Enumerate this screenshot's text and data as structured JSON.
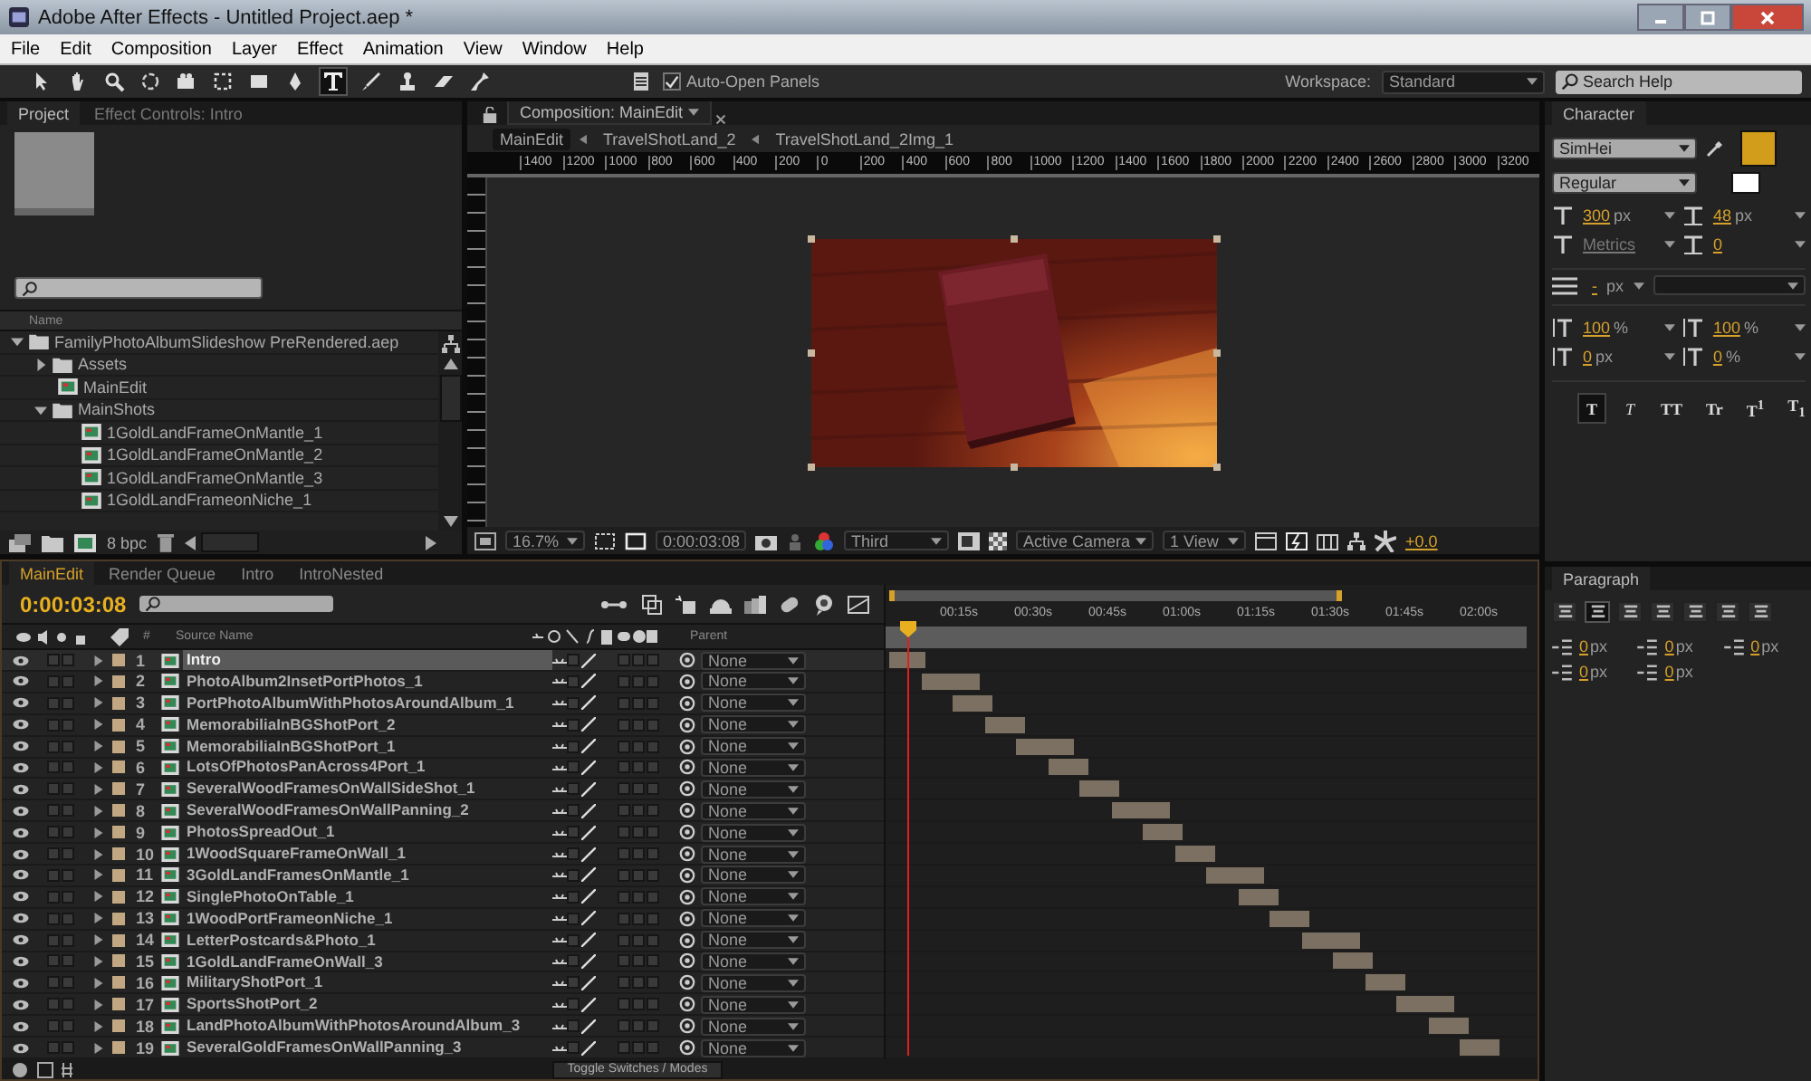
{
  "window": {
    "title": "Adobe After Effects - Untitled Project.aep *"
  },
  "menu": [
    "File",
    "Edit",
    "Composition",
    "Layer",
    "Effect",
    "Animation",
    "View",
    "Window",
    "Help"
  ],
  "toolbar": {
    "auto_open_panels": {
      "label": "Auto-Open Panels",
      "checked": true
    },
    "workspace_label": "Workspace:",
    "workspace": "Standard",
    "search_placeholder": "Search Help"
  },
  "project": {
    "tabs": [
      {
        "label": "Project",
        "selected": true
      },
      {
        "label": "Effect Controls: Intro",
        "selected": false
      }
    ],
    "column": "Name",
    "bpc": "8 bpc",
    "items": [
      {
        "name": "FamilyPhotoAlbumSlideshow PreRendered.aep",
        "kind": "folder",
        "expanded": true,
        "children": [
          {
            "name": "Assets",
            "kind": "folder",
            "expanded": false
          },
          {
            "name": "MainEdit",
            "kind": "comp"
          },
          {
            "name": "MainShots",
            "kind": "folder",
            "expanded": true,
            "children": [
              {
                "name": "1GoldLandFrameOnMantle_1",
                "kind": "comp"
              },
              {
                "name": "1GoldLandFrameOnMantle_2",
                "kind": "comp"
              },
              {
                "name": "1GoldLandFrameOnMantle_3",
                "kind": "comp"
              },
              {
                "name": "1GoldLandFrameonNiche_1",
                "kind": "comp"
              }
            ]
          }
        ]
      }
    ]
  },
  "composition": {
    "tab": "Composition: MainEdit",
    "breadcrumbs": [
      {
        "label": "MainEdit",
        "selected": true
      },
      {
        "label": "TravelShotLand_2",
        "selected": false
      },
      {
        "label": "TravelShotLand_2Img_1",
        "selected": false
      }
    ],
    "ruler": [
      "1400",
      "1200",
      "1000",
      "800",
      "600",
      "400",
      "200",
      "0",
      "200",
      "400",
      "600",
      "800",
      "1000",
      "1200",
      "1400",
      "1600",
      "1800",
      "2000",
      "2200",
      "2400",
      "2600",
      "2800",
      "3000",
      "3200"
    ],
    "zoom": "16.7%",
    "timecode": "0:00:03:08",
    "resolution": "Third",
    "camera": "Active Camera",
    "views": "1 View",
    "exposure": "+0.0"
  },
  "character": {
    "tab": "Character",
    "font": "SimHei",
    "style": "Regular",
    "fields": [
      {
        "value": "300",
        "unit": "px"
      },
      {
        "value": "48",
        "unit": "px"
      },
      {
        "value": "Metrics"
      },
      {
        "value": "0"
      }
    ],
    "stroke": {
      "value": "-",
      "unit": "px"
    },
    "scale_fields": [
      {
        "value": "100",
        "unit": "%"
      },
      {
        "value": "100",
        "unit": "%"
      },
      {
        "value": "0",
        "unit": "px"
      },
      {
        "value": "0",
        "unit": "%"
      }
    ],
    "styles": [
      {
        "label": "T",
        "selected": true
      },
      {
        "label": "T",
        "selected": false
      },
      {
        "label": "TT",
        "selected": false
      },
      {
        "label": "Tr",
        "selected": false
      },
      {
        "label": "T$^{1}$",
        "selected": false
      },
      {
        "label": "T$_{1}$",
        "selected": false
      }
    ]
  },
  "paragraph": {
    "tab": "Paragraph",
    "alignments": [
      {
        "selected": false
      },
      {
        "selected": true
      },
      {
        "selected": false
      },
      {
        "selected": false
      },
      {
        "selected": false
      },
      {
        "selected": false
      },
      {
        "selected": false
      }
    ],
    "indents": [
      {
        "value": "0",
        "unit": "px"
      },
      {
        "value": "0",
        "unit": "px"
      },
      {
        "value": "0",
        "unit": "px"
      },
      {
        "value": "0",
        "unit": "px"
      },
      {
        "value": "0",
        "unit": "px"
      }
    ]
  },
  "timeline": {
    "tabs": [
      {
        "label": "MainEdit",
        "selected": true
      },
      {
        "label": "Render Queue",
        "selected": false
      },
      {
        "label": "Intro",
        "selected": false
      },
      {
        "label": "IntroNested",
        "selected": false
      }
    ],
    "timecode": "0:00:03:08",
    "columns": {
      "number": "#",
      "source": "Source Name",
      "parent": "Parent"
    },
    "time_ticks": [
      "00:15s",
      "00:30s",
      "00:45s",
      "01:00s",
      "01:15s",
      "01:30s",
      "01:45s",
      "02:00s"
    ],
    "layers": [
      {
        "number": "1",
        "name": "Intro",
        "parent": "None",
        "selected": true
      },
      {
        "number": "2",
        "name": "PhotoAlbum2InsetPortPhotos_1",
        "parent": "None",
        "selected": false
      },
      {
        "number": "3",
        "name": "PortPhotoAlbumWithPhotosAroundAlbum_1",
        "parent": "None",
        "selected": false
      },
      {
        "number": "4",
        "name": "MemorabiliaInBGShotPort_2",
        "parent": "None",
        "selected": false
      },
      {
        "number": "5",
        "name": "MemorabiliaInBGShotPort_1",
        "parent": "None",
        "selected": false
      },
      {
        "number": "6",
        "name": "LotsOfPhotosPanAcross4Port_1",
        "parent": "None",
        "selected": false
      },
      {
        "number": "7",
        "name": "SeveralWoodFramesOnWallSideShot_1",
        "parent": "None",
        "selected": false
      },
      {
        "number": "8",
        "name": "SeveralWoodFramesOnWallPanning_2",
        "parent": "None",
        "selected": false
      },
      {
        "number": "9",
        "name": "PhotosSpreadOut_1",
        "parent": "None",
        "selected": false
      },
      {
        "number": "10",
        "name": "1WoodSquareFrameOnWall_1",
        "parent": "None",
        "selected": false
      },
      {
        "number": "11",
        "name": "3GoldLandFramesOnMantle_1",
        "parent": "None",
        "selected": false
      },
      {
        "number": "12",
        "name": "SinglePhotoOnTable_1",
        "parent": "None",
        "selected": false
      },
      {
        "number": "13",
        "name": "1WoodPortFrameonNiche_1",
        "parent": "None",
        "selected": false
      },
      {
        "number": "14",
        "name": "LetterPostcards&Photo_1",
        "parent": "None",
        "selected": false
      },
      {
        "number": "15",
        "name": "1GoldLandFrameOnWall_3",
        "parent": "None",
        "selected": false
      },
      {
        "number": "16",
        "name": "MilitaryShotPort_1",
        "parent": "None",
        "selected": false
      },
      {
        "number": "17",
        "name": "SportsShotPort_2",
        "parent": "None",
        "selected": false
      },
      {
        "number": "18",
        "name": "LandPhotoAlbumWithPhotosAroundAlbum_3",
        "parent": "None",
        "selected": false
      },
      {
        "number": "19",
        "name": "SeveralGoldFramesOnWallPanning_3",
        "parent": "None",
        "selected": false
      }
    ],
    "footer": "Toggle Switches / Modes"
  }
}
